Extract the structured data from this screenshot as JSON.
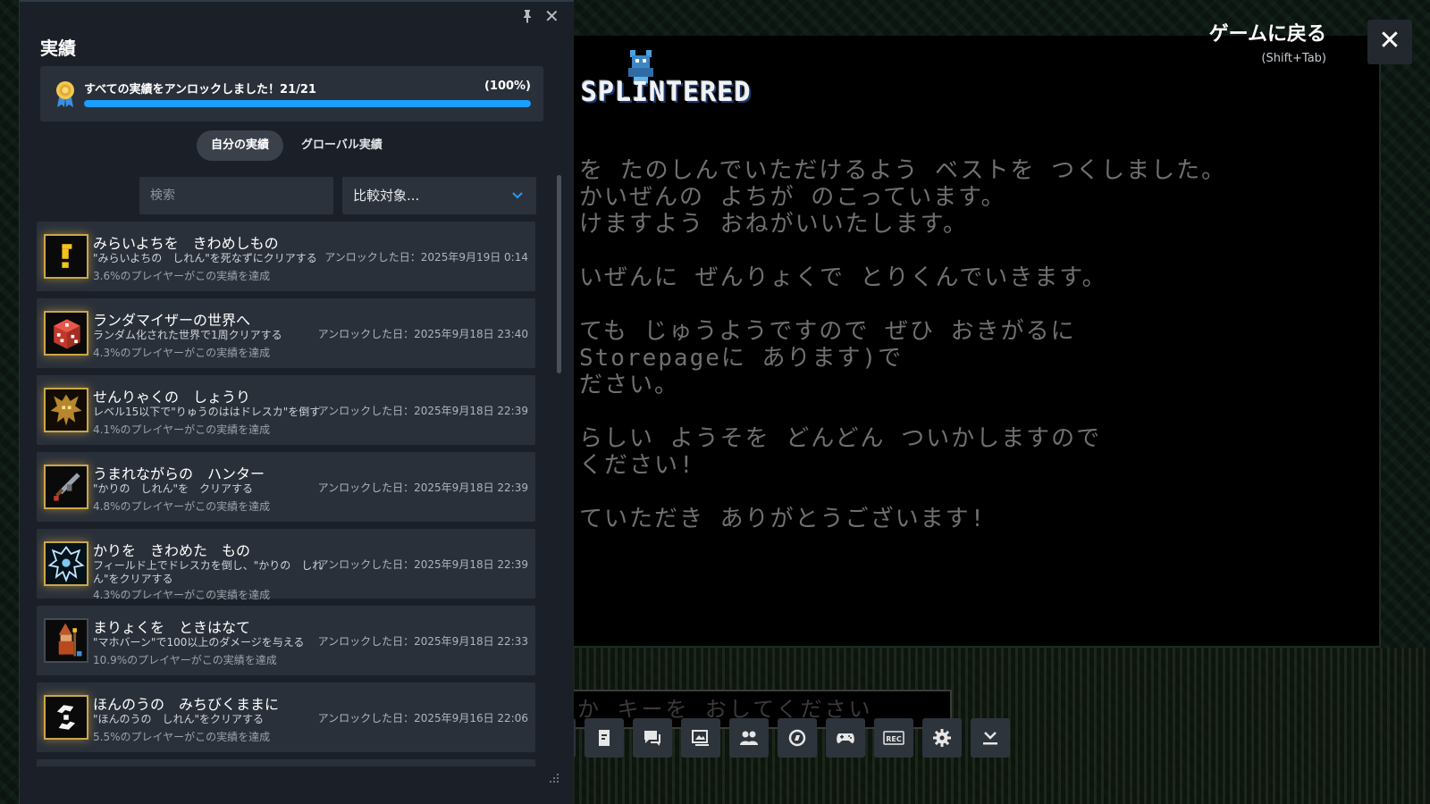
{
  "game": {
    "logo_text": "SPLINTERED",
    "lines": [
      "を たのしんでいただけるよう ベストを つくしました。",
      "かいぜんの よちが のこっています。",
      "けますよう おねがいいたします。",
      "",
      "いぜんに ぜんりょくで とりくんでいきます。",
      "",
      "ても じゅうようですので ぜひ おきがるに",
      " Storepageに あります)で",
      "ださい。",
      "",
      "らしい ようそを どんどん ついかしますので",
      "ください!",
      "",
      "ていただき ありがとうございます!"
    ],
    "prompt_text": "か キーを おしてください"
  },
  "overlay": {
    "return_label": "ゲームに戻る",
    "return_hint": "(Shift+Tab)",
    "close_glyph": "✕"
  },
  "panel": {
    "title": "実績",
    "close_glyph": "✕",
    "progress": {
      "text": "すべての実績をアンロックしました！21/21",
      "percent_label": "(100%)",
      "fraction": 1.0
    },
    "tabs": [
      {
        "label": "自分の実績",
        "active": true
      },
      {
        "label": "グローバル実績",
        "active": false
      }
    ],
    "search": {
      "placeholder": "検索",
      "value": ""
    },
    "compare": {
      "label": "比較対象..."
    },
    "achievements": [
      {
        "name": "みらいよちを　きわめしもの",
        "desc": "\"みらいよちの　しれん\"を死なずにクリアする",
        "pct": "3.6%のプレイヤーがこの実績を達成",
        "date": "アンロックした日：2025年9月19日 0:14",
        "icon": "exclaim-icon"
      },
      {
        "name": "ランダマイザーの世界へ",
        "desc": "ランダム化された世界で1周クリアする",
        "pct": "4.3%のプレイヤーがこの実績を達成",
        "date": "アンロックした日：2025年9月18日 23:40",
        "icon": "dice-icon"
      },
      {
        "name": "せんりゃくの　しょうり",
        "desc": "レベル15以下で\"りゅうのははドレスカ\"を倒す",
        "pct": "4.1%のプレイヤーがこの実績を達成",
        "date": "アンロックした日：2025年9月18日 22:39",
        "icon": "dragon-icon"
      },
      {
        "name": "うまれながらの　ハンター",
        "desc": "\"かりの　しれん\"を　クリアする",
        "pct": "4.8%のプレイヤーがこの実績を達成",
        "date": "アンロックした日：2025年9月18日 22:39",
        "icon": "sword-icon"
      },
      {
        "name": "かりを　きわめた　もの",
        "desc": "フィールド上でドレスカを倒し、\"かりの　しれん\"をクリアする",
        "pct": "4.3%のプレイヤーがこの実績を達成",
        "date": "アンロックした日：2025年9月18日 22:39",
        "icon": "skeleton-icon"
      },
      {
        "name": "まりょくを　ときはなて",
        "desc": "\"マホバーン\"で100以上のダメージを与える",
        "pct": "10.9%のプレイヤーがこの実績を達成",
        "date": "アンロックした日：2025年9月18日 22:33",
        "icon": "mage-icon"
      },
      {
        "name": "ほんのうの　みちびくままに",
        "desc": "\"ほんのうの　しれん\"をクリアする",
        "pct": "5.5%のプレイヤーがこの実績を達成",
        "date": "アンロックした日：2025年9月16日 22:06",
        "icon": "swirl-icon"
      }
    ]
  },
  "toolbar": {
    "rec_label": "REC",
    "buttons": [
      "partial-icon",
      "guide-icon",
      "chat-icon",
      "screenshot-icon",
      "friends-icon",
      "browser-icon",
      "controller-icon",
      "rec-icon",
      "settings-icon",
      "download-icon"
    ]
  },
  "colors": {
    "panel_bg": "#1b2028",
    "card_bg": "#2a303a",
    "accent": "#1a9fff",
    "gold": "#c9a74a"
  }
}
